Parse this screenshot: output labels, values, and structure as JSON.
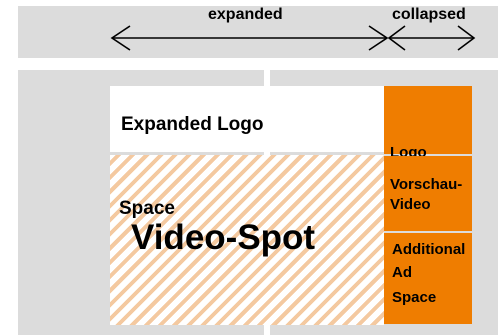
{
  "header": {
    "expanded_label": "expanded",
    "collapsed_label": "collapsed"
  },
  "layout": {
    "expanded_logo_label": "Expanded Logo",
    "space_label": "Space",
    "video_spot_label": "Video-Spot",
    "sidebar": {
      "logo_label": "Logo",
      "preview_line1": "Vorschau-",
      "preview_line2": "Video",
      "additional_line1": "Additional",
      "additional_line2": "Ad",
      "additional_line3": "Space"
    }
  },
  "colors": {
    "gray": "#dcdcdc",
    "orange": "#ef7d00",
    "stripe": "#f4c9a0"
  }
}
